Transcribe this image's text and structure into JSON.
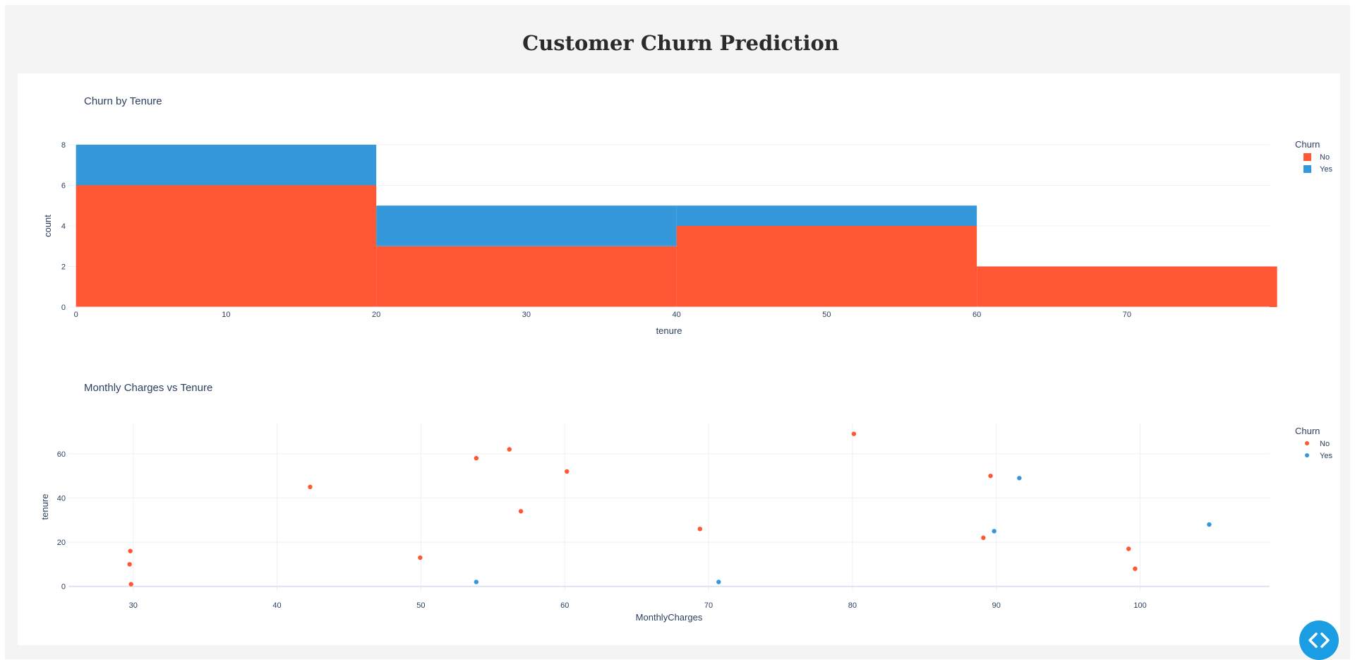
{
  "page": {
    "title": "Customer Churn Prediction"
  },
  "colors": {
    "No": "#ff5733",
    "Yes": "#3498db",
    "fab": "#1b9de4"
  },
  "fab": {
    "icon": "code-icon"
  },
  "chart_data": [
    {
      "type": "bar",
      "title": "Churn by Tenure",
      "xlabel": "tenure",
      "ylabel": "count",
      "barmode": "stack",
      "bin_edges": [
        0,
        20,
        40,
        60,
        80
      ],
      "xlim": [
        -0.5,
        79.5
      ],
      "ylim": [
        0,
        8
      ],
      "xticks": [
        0,
        10,
        20,
        30,
        40,
        50,
        60,
        70
      ],
      "yticks": [
        0,
        2,
        4,
        6,
        8
      ],
      "grid": true,
      "legend_title": "Churn",
      "legend_placement": "top-right",
      "series": [
        {
          "name": "No",
          "values": [
            6,
            3,
            4,
            2
          ]
        },
        {
          "name": "Yes",
          "values": [
            2,
            2,
            1,
            0
          ]
        }
      ]
    },
    {
      "type": "scatter",
      "title": "Monthly Charges vs Tenure",
      "xlabel": "MonthlyCharges",
      "ylabel": "tenure",
      "xlim": [
        25.5,
        109
      ],
      "ylim": [
        -2,
        74
      ],
      "xticks": [
        30,
        40,
        50,
        60,
        70,
        80,
        90,
        100
      ],
      "yticks": [
        0,
        20,
        40,
        60
      ],
      "grid": true,
      "legend_title": "Churn",
      "legend_placement": "top-right",
      "series": [
        {
          "name": "No",
          "points": [
            [
              29.85,
              1
            ],
            [
              29.75,
              10
            ],
            [
              29.8,
              16
            ],
            [
              42.3,
              45
            ],
            [
              49.95,
              13
            ],
            [
              53.85,
              58
            ],
            [
              56.15,
              62
            ],
            [
              56.95,
              34
            ],
            [
              60.15,
              52
            ],
            [
              69.4,
              26
            ],
            [
              80.1,
              69
            ],
            [
              89.1,
              22
            ],
            [
              89.6,
              50
            ],
            [
              99.2,
              17
            ],
            [
              99.65,
              8
            ]
          ]
        },
        {
          "name": "Yes",
          "points": [
            [
              53.85,
              2
            ],
            [
              70.7,
              2
            ],
            [
              89.85,
              25
            ],
            [
              91.6,
              49
            ],
            [
              104.8,
              28
            ]
          ]
        }
      ]
    }
  ]
}
